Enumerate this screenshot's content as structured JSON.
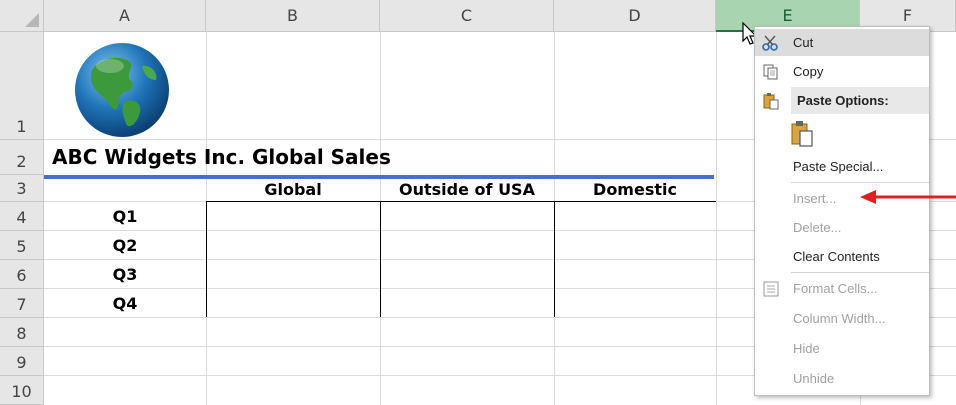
{
  "columns": [
    "A",
    "B",
    "C",
    "D",
    "E",
    "F"
  ],
  "rows": [
    "1",
    "2",
    "3",
    "4",
    "5",
    "6",
    "7",
    "8",
    "9",
    "10"
  ],
  "sheet": {
    "title": "ABC Widgets Inc. Global Sales",
    "headers": [
      "Global",
      "Outside of USA",
      "Domestic"
    ],
    "quarters": [
      "Q1",
      "Q2",
      "Q3",
      "Q4"
    ]
  },
  "selected_column": "E",
  "context_menu": {
    "cut": "Cut",
    "copy": "Copy",
    "paste_options": "Paste Options:",
    "paste_special": "Paste Special...",
    "insert": "Insert...",
    "delete": "Delete...",
    "clear_contents": "Clear Contents",
    "format_cells": "Format Cells...",
    "column_width": "Column Width...",
    "hide": "Hide",
    "unhide": "Unhide"
  },
  "colors": {
    "header_bg": "#e6e6e6",
    "selected_header": "#a9d4b0",
    "title_underline": "#4472c4",
    "annotation_arrow": "#e02020"
  },
  "icons": [
    "globe-image",
    "scissors-icon",
    "copy-icon",
    "paste-icon",
    "paste-clipboard-icon",
    "format-cells-icon",
    "mouse-cursor-icon",
    "red-arrow-icon"
  ]
}
